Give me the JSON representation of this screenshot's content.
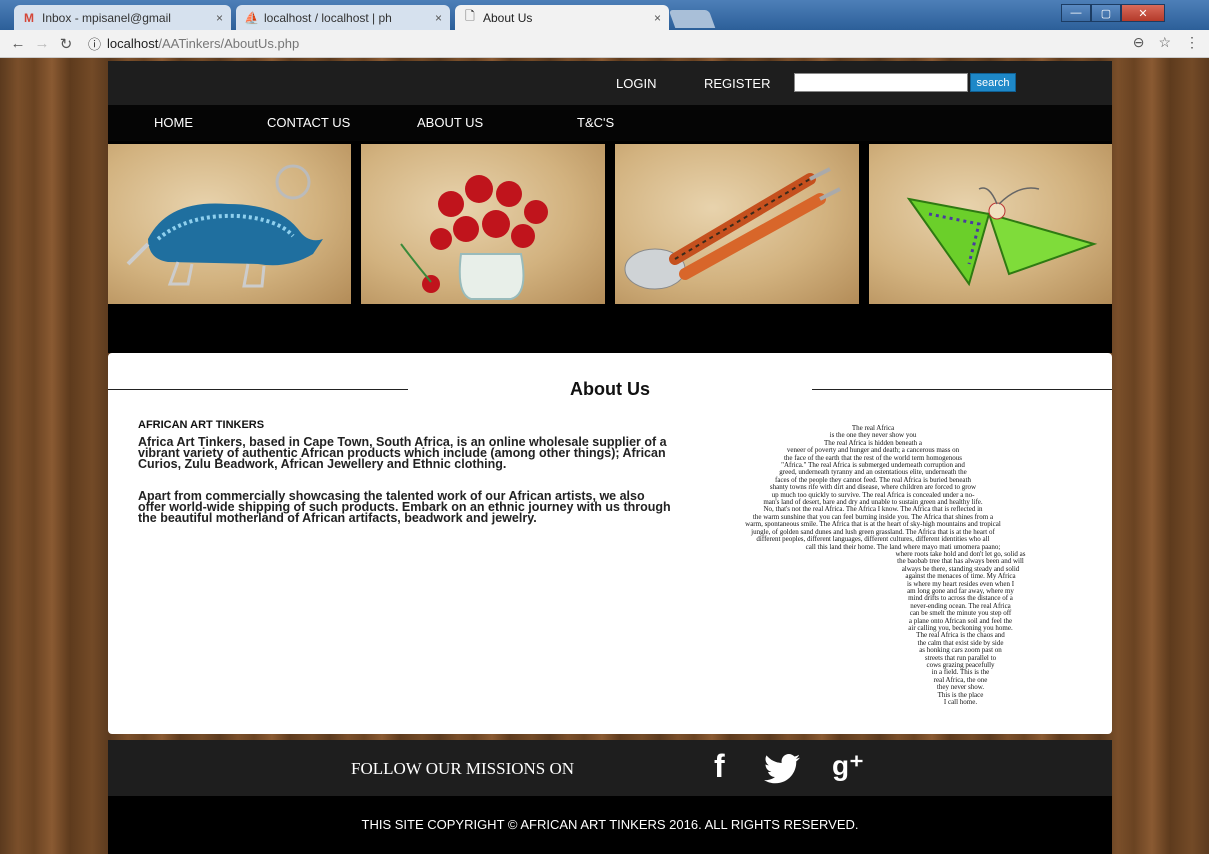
{
  "browser": {
    "tabs": [
      {
        "icon": "gmail-icon",
        "label": "Inbox - mpisanel@gmail",
        "close": "×"
      },
      {
        "icon": "phpmyadmin-icon",
        "label": "localhost / localhost | ph",
        "close": "×"
      },
      {
        "icon": "page-icon",
        "label": "About Us",
        "close": "×"
      }
    ],
    "url_host": "localhost",
    "url_path": "/AATinkers/AboutUs.php",
    "window_controls": [
      "—",
      "▢",
      "✕"
    ]
  },
  "header": {
    "login": "LOGIN",
    "register": "REGISTER",
    "search_value": "",
    "search_button": "search"
  },
  "nav": [
    "HOME",
    "CONTACT US",
    "ABOUT US",
    "T&C'S"
  ],
  "banner": {
    "tiles": [
      "rhino-beadwork",
      "rose-vase-beadwork",
      "spoon-fork-beadwork",
      "butterfly-beadwork"
    ]
  },
  "about": {
    "title": "About Us",
    "company": "AFRICAN ART TINKERS",
    "paragraph1": "Africa Art Tinkers, based in Cape Town, South Africa, is an online wholesale supplier of a vibrant variety of authentic African products which include (among other things); African Curios, Zulu Beadwork, African Jewellery and Ethnic clothing.",
    "paragraph2": "Apart from commercially showcasing the talented work of our African artists, we also offer world-wide shipping of such products. Embark on an ethnic journey with us through the beautiful motherland of African artifacts, beadwork and jewelry.",
    "poem_lines": [
      "The real Africa",
      "is the one they never show you",
      "The real Africa is hidden beneath a",
      "veneer of poverty and hunger and death; a cancerous mass on",
      "the face of the earth that the rest of the world term homogenous",
      "\"Africa.\" The real Africa is submerged underneath corruption and",
      "greed, underneath tyranny and an ostentatious elite, underneath the",
      "faces of the people they cannot feed. The real Africa is buried beneath",
      "shanty towns rife with dirt and disease, where children are forced to grow",
      "up much too quickly to survive. The real Africa is concealed under a no-",
      "man's land of desert, bare and dry and unable to sustain green and healthy life.",
      "No, that's not the real Africa. The Africa I know. The Africa that is reflected in",
      "the warm sunshine that you can feel burning inside you. The Africa that shines from a",
      "warm, spontaneous smile. The Africa that is at the heart of sky-high mountains and tropical",
      "jungle, of golden sand dunes and lush green grassland. The Africa that is at the heart of",
      "different peoples, different languages, different cultures, different identities who all",
      "call this land their home. The land where mayo mati umomera paano;",
      "where roots take hold and don't let go, solid as",
      "the baobab tree that has always been and will",
      "always be there, standing steady and solid",
      "against the menaces of time. My Africa",
      "is where my heart resides even when I",
      "am long gone and far away, where my",
      "mind drifts to across the distance of a",
      "never-ending ocean. The real Africa",
      "can be smelt the minute you step off",
      "a plane onto African soil and feel the",
      "air calling you, beckoning you home.",
      "The real Africa is the chaos and",
      "the calm that exist side by side",
      "as honking cars zoom past on",
      "streets that run parallel to",
      "cows grazing peacefully",
      "in a field. This is the",
      "real Africa, the one",
      "they never show.",
      "This is the place",
      "I call home."
    ]
  },
  "footer": {
    "follow": "FOLLOW OUR MISSIONS ON",
    "social": [
      {
        "icon": "facebook-icon",
        "glyph": "f"
      },
      {
        "icon": "twitter-icon",
        "glyph": ""
      },
      {
        "icon": "google-plus-icon",
        "glyph": "g⁺"
      }
    ],
    "copyright": "THIS SITE COPYRIGHT © AFRICAN ART TINKERS 2016. ALL RIGHTS RESERVED."
  },
  "colors": {
    "header_bg": "#1e1e1e",
    "nav_bg": "#050505",
    "search_button": "#1e88c8",
    "wood": "#6a4322"
  }
}
